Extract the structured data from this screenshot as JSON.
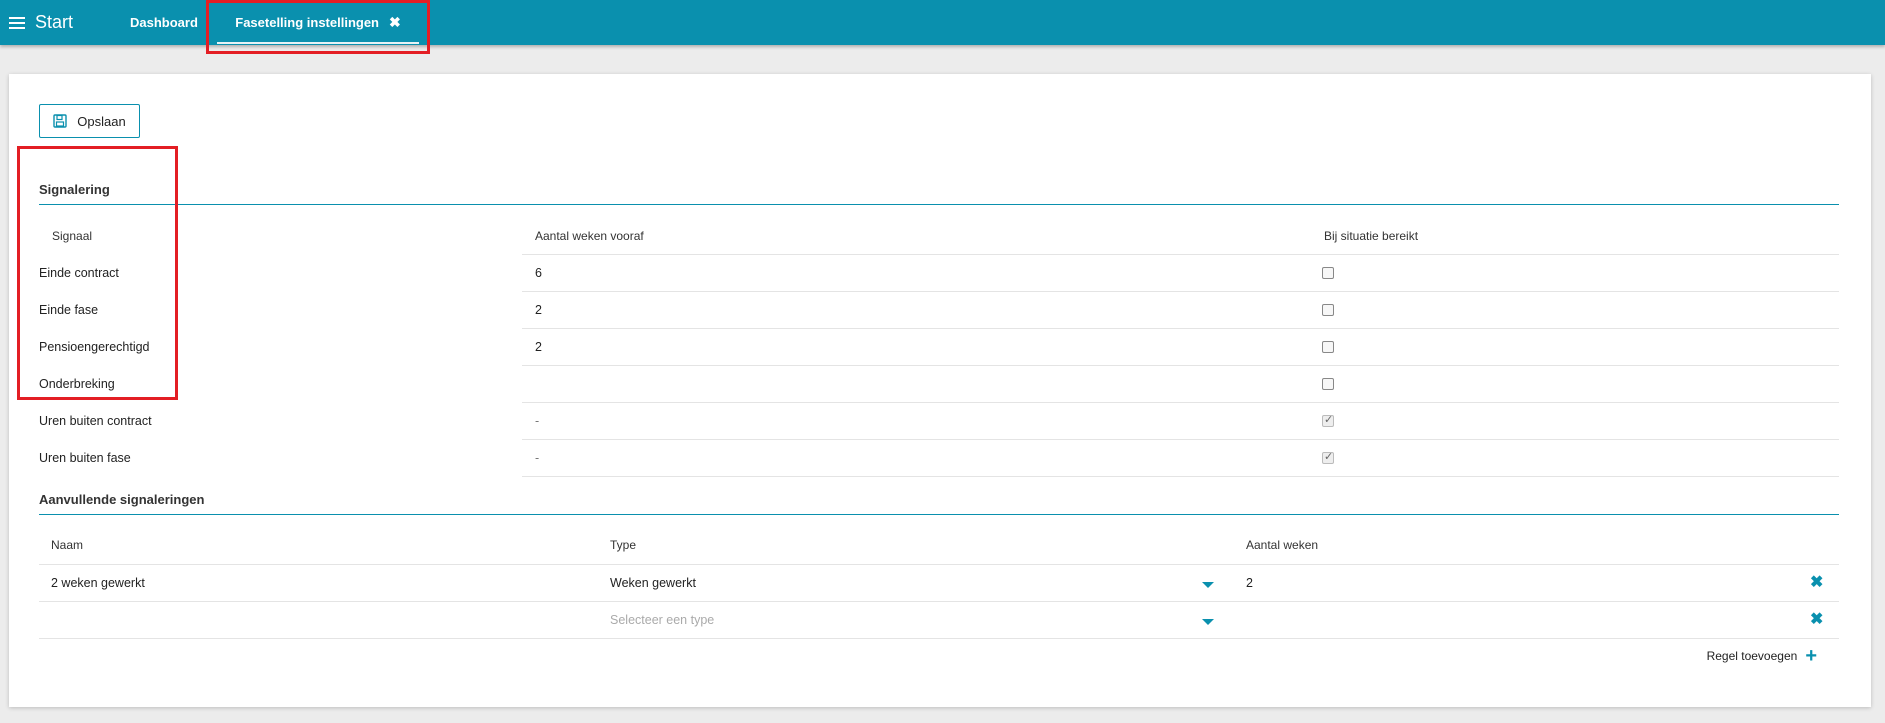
{
  "header": {
    "brand": "Start",
    "tabs": [
      {
        "label": "Dashboard"
      },
      {
        "label": "Fasetelling instellingen",
        "close": "✖"
      }
    ]
  },
  "toolbar": {
    "save_label": "Opslaan"
  },
  "signalering": {
    "title": "Signalering",
    "columns": [
      "Signaal",
      "Aantal weken vooraf",
      "Bij situatie bereikt"
    ],
    "rows": [
      {
        "signaal": "Einde contract",
        "weken": "6",
        "checked": false
      },
      {
        "signaal": "Einde fase",
        "weken": "2",
        "checked": false
      },
      {
        "signaal": "Pensioengerechtigd",
        "weken": "2",
        "checked": false
      },
      {
        "signaal": "Onderbreking",
        "weken": "",
        "checked": false
      },
      {
        "signaal": "Uren buiten contract",
        "weken": "-",
        "checked": true
      },
      {
        "signaal": "Uren buiten fase",
        "weken": "-",
        "checked": true
      }
    ]
  },
  "aanvullend": {
    "title": "Aanvullende signaleringen",
    "columns": [
      "Naam",
      "Type",
      "Aantal weken"
    ],
    "rows": [
      {
        "naam": "2 weken gewerkt",
        "type": "Weken gewerkt",
        "weken": "2"
      },
      {
        "naam": "",
        "type_placeholder": "Selecteer een type",
        "weken": ""
      }
    ],
    "add_label": "Regel toevoegen"
  },
  "colors": {
    "accent": "#0a90ae",
    "highlight": "#e31e24"
  }
}
